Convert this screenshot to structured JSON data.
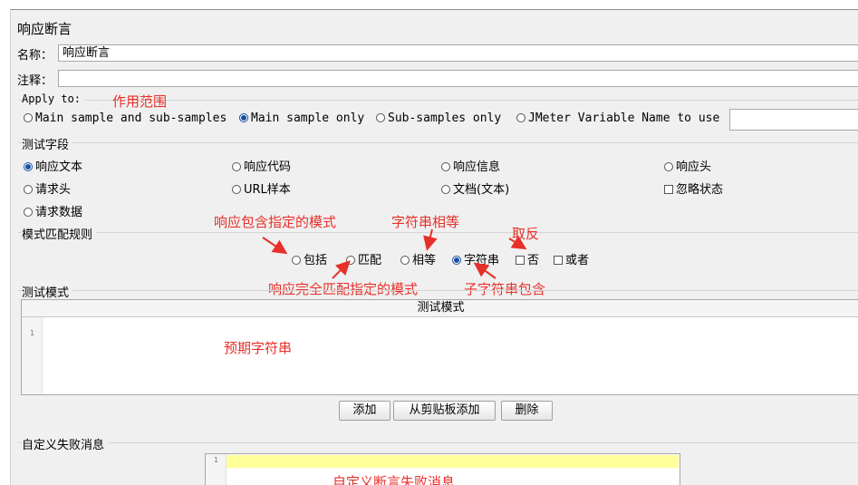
{
  "panel_title": "响应断言",
  "name_label": "名称：",
  "name_value": "响应断言",
  "comment_label": "注释：",
  "comment_value": "",
  "apply_to": {
    "legend": "Apply to:",
    "options": [
      "Main sample and sub-samples",
      "Main sample only",
      "Sub-samples only",
      "JMeter Variable Name to use"
    ],
    "selected": "Main sample only",
    "variable_value": ""
  },
  "test_field": {
    "legend": "测试字段",
    "options": [
      "响应文本",
      "响应代码",
      "响应信息",
      "响应头",
      "请求头",
      "URL样本",
      "文档(文本)",
      "请求数据"
    ],
    "selected": "响应文本",
    "ignore_status_label": "忽略状态"
  },
  "pattern_rules": {
    "legend": "模式匹配规则",
    "options": [
      "包括",
      "匹配",
      "相等",
      "字符串"
    ],
    "selected": "字符串",
    "not_label": "否",
    "or_label": "或者"
  },
  "test_patterns": {
    "legend": "测试模式",
    "column_header": "测试模式",
    "line_number": "1",
    "add_button": "添加",
    "paste_button": "从剪贴板添加",
    "delete_button": "删除"
  },
  "custom_failure": {
    "legend": "自定义失败消息",
    "line_number": "1"
  },
  "annotations": {
    "scope": "作用范围",
    "contains_pattern": "响应包含指定的模式",
    "string_equals": "字符串相等",
    "negate": "取反",
    "full_match": "响应完全匹配指定的模式",
    "substring": "子字符串包含",
    "expected_string": "预期字符串",
    "custom_failure_msg": "自定义断言失败消息"
  },
  "colors": {
    "annotation": "#e8302a",
    "selected_radio": "#1a4fa0",
    "highlight_line": "#ffff99"
  }
}
